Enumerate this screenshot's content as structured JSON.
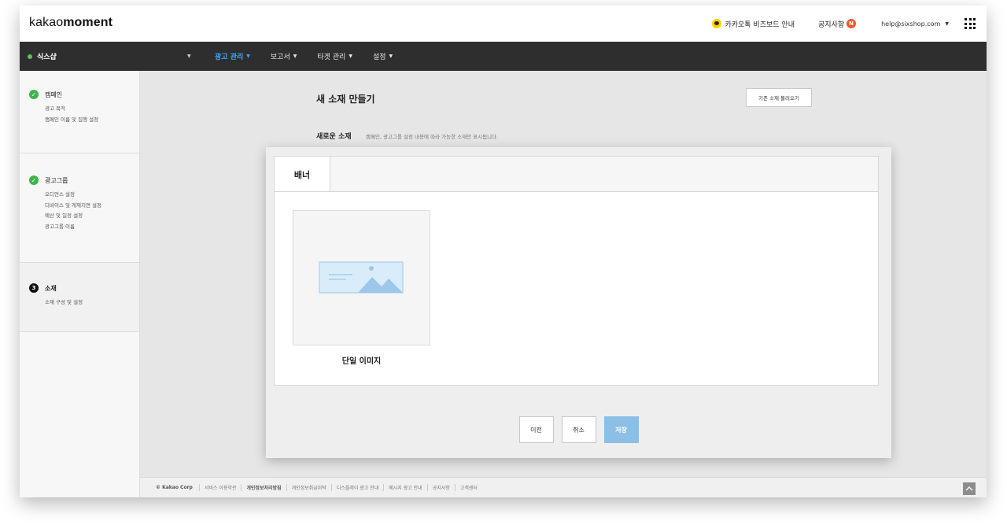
{
  "brand": {
    "light": "kakao",
    "bold": "moment"
  },
  "topbar": {
    "bizboard_label": "카카오톡 비즈보드 안내",
    "notice_label": "공지사항",
    "notice_badge": "N",
    "user_email": "help@sixshop.com",
    "caret": "▼"
  },
  "nav": {
    "account": "식스샵",
    "account_caret": "▼",
    "items": [
      {
        "label": "광고 관리",
        "active": true
      },
      {
        "label": "보고서"
      },
      {
        "label": "타겟 관리"
      },
      {
        "label": "설정"
      }
    ],
    "caret": "▼"
  },
  "sidebar": {
    "steps": [
      {
        "title": "캠페인",
        "status": "done",
        "mark": "✓",
        "items": [
          "광고 목적",
          "캠페인 이름 및 집행 설정"
        ]
      },
      {
        "title": "광고그룹",
        "status": "done",
        "mark": "✓",
        "items": [
          "오디언스 설정",
          "디바이스 및 게재지면 설정",
          "예산 및 일정 설정",
          "광고그룹 이름"
        ]
      },
      {
        "title": "소재",
        "status": "current",
        "mark": "3",
        "items": [
          "소재 구성 및 설정"
        ]
      }
    ]
  },
  "main": {
    "title": "새 소재 만들기",
    "load_button": "기존 소재 불러오기",
    "section_label": "새로운 소재",
    "section_desc": "캠페인, 광고그룹 설정 내용에 따라 가능한 소재만 표시됩니다."
  },
  "modal": {
    "tab": "배너",
    "card_label": "단일 이미지",
    "buttons": {
      "prev": "이전",
      "cancel": "취소",
      "save": "저장"
    }
  },
  "footer": {
    "corp": "© Kakao Corp",
    "links": [
      {
        "label": "서비스 이용약관",
        "bold": false
      },
      {
        "label": "개인정보처리방침",
        "bold": true
      },
      {
        "label": "개인정보취급위탁",
        "bold": false
      },
      {
        "label": "디스플레이 광고 안내",
        "bold": false
      },
      {
        "label": "메시지 광고 안내",
        "bold": false
      },
      {
        "label": "공지사항",
        "bold": false
      },
      {
        "label": "고객센터",
        "bold": false
      }
    ]
  },
  "colors": {
    "accent": "#3ea5ff",
    "check": "#3cb44b",
    "save": "#8bbfe6"
  }
}
